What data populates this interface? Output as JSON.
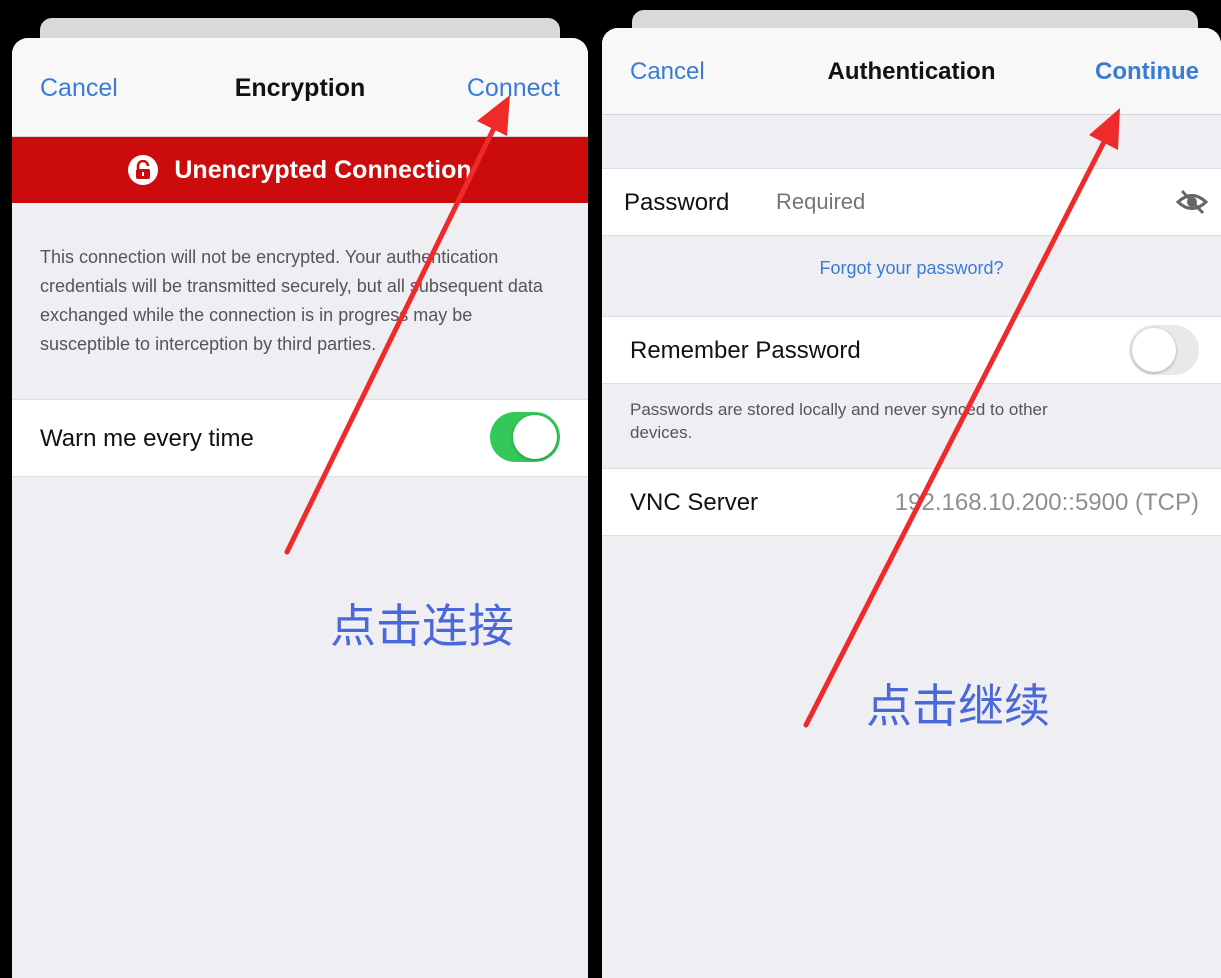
{
  "colors": {
    "accent_blue": "#3a7bd5",
    "danger_red": "#cc0c0c",
    "toggle_on": "#34c759",
    "toggle_off": "#e9e9eb",
    "annotation_blue": "#4a68d8",
    "arrow_red": "#ee2a2a"
  },
  "left_screen": {
    "nav": {
      "cancel": "Cancel",
      "title": "Encryption",
      "connect": "Connect"
    },
    "banner": {
      "icon": "open-lock-icon",
      "text": "Unencrypted Connection"
    },
    "description": "This connection will not be encrypted. Your authentication credentials will be transmitted securely, but all subsequent data exchanged while the connection is in progress may be susceptible to interception by third parties.",
    "warn_row": {
      "label": "Warn me every time",
      "toggle_on": true
    },
    "annotation": "点击连接"
  },
  "right_screen": {
    "nav": {
      "cancel": "Cancel",
      "title": "Authentication",
      "continue": "Continue"
    },
    "password_row": {
      "label": "Password",
      "placeholder": "Required",
      "icon": "eye-slash-icon"
    },
    "forgot_link": "Forgot your password?",
    "remember_row": {
      "label": "Remember Password",
      "toggle_on": false
    },
    "remember_note": "Passwords are stored locally and never synced to other devices.",
    "server_row": {
      "label": "VNC Server",
      "value": "192.168.10.200::5900 (TCP)"
    },
    "annotation": "点击继续"
  }
}
